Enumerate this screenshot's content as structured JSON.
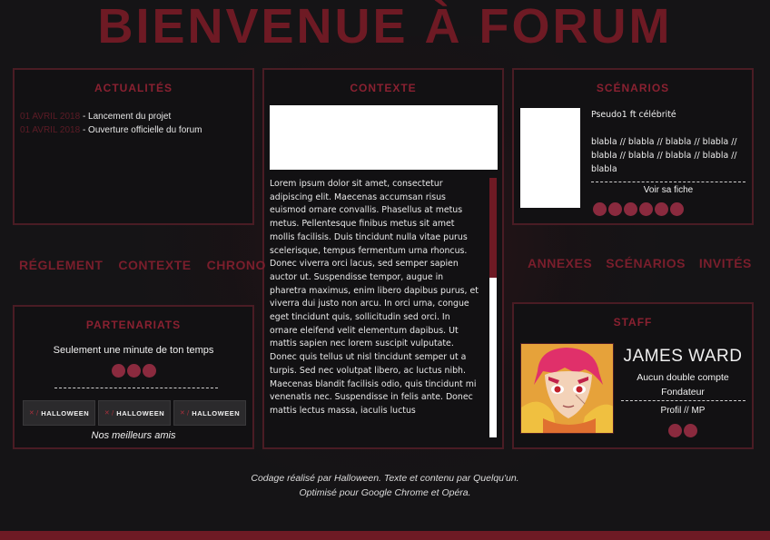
{
  "header": {
    "title": "BIENVENUE À FORUM"
  },
  "actualites": {
    "title": "ACTUALITÉS",
    "items": [
      {
        "date": "01 AVRIL 2018",
        "text": " - Lancement du projet"
      },
      {
        "date": "01 AVRIL 2018",
        "text": " - Ouverture officielle du forum"
      }
    ]
  },
  "contexte": {
    "title": "CONTEXTE",
    "text": "Lorem ipsum dolor sit amet, consectetur adipiscing elit. Maecenas accumsan risus euismod ornare convallis. Phasellus at metus metus. Pellentesque finibus metus sit amet mollis facilisis. Duis tincidunt nulla vitae purus scelerisque, tempus fermentum urna rhoncus. Donec viverra orci lacus, sed semper sapien auctor ut. Suspendisse tempor, augue in pharetra maximus, enim libero dapibus purus, et viverra dui justo non arcu. In orci urna, congue eget tincidunt quis, sollicitudin sed orci. In ornare eleifend velit elementum dapibus. Ut mattis sapien nec lorem suscipit vulputate. Donec quis tellus ut nisl tincidunt semper ut a turpis. Sed nec volutpat libero, ac luctus nibh. Maecenas blandit facilisis odio, quis tincidunt mi venenatis nec. Suspendisse in felis ante. Donec mattis lectus massa, iaculis luctus"
  },
  "scenarios": {
    "title": "SCÉNARIOS",
    "name": "Pseudo1 ft célébrité",
    "description": "blabla // blabla // blabla // blabla // blabla // blabla // blabla // blabla // blabla",
    "link": "Voir sa fiche",
    "dot_count": 6
  },
  "nav_left": {
    "items": [
      "RÉGLEMENT",
      "CONTEXTE",
      "CHRONO"
    ]
  },
  "nav_right": {
    "items": [
      "ANNEXES",
      "SCÉNARIOS",
      "INVITÉS"
    ]
  },
  "partenariats": {
    "title": "PARTENARIATS",
    "text": "Seulement une minute de ton temps",
    "banner_mark": "✕ /",
    "banner_text": "HALLOWEEN",
    "footer": "Nos meilleurs amis",
    "dot_count": 3
  },
  "staff": {
    "title": "STAFF",
    "name": "JAMES WARD",
    "line1": "Aucun double compte",
    "line2": "Fondateur",
    "link": "Profil // MP",
    "dot_count": 2
  },
  "footer": {
    "line1": "Codage réalisé par Halloween. Texte et contenu par Quelqu'un.",
    "line2": "Optimisé pour Google Chrome et Opéra."
  },
  "colors": {
    "accent": "#6e1a24",
    "panel_border": "#4a1c24",
    "dot": "#8a2a3e",
    "background": "#151416"
  }
}
